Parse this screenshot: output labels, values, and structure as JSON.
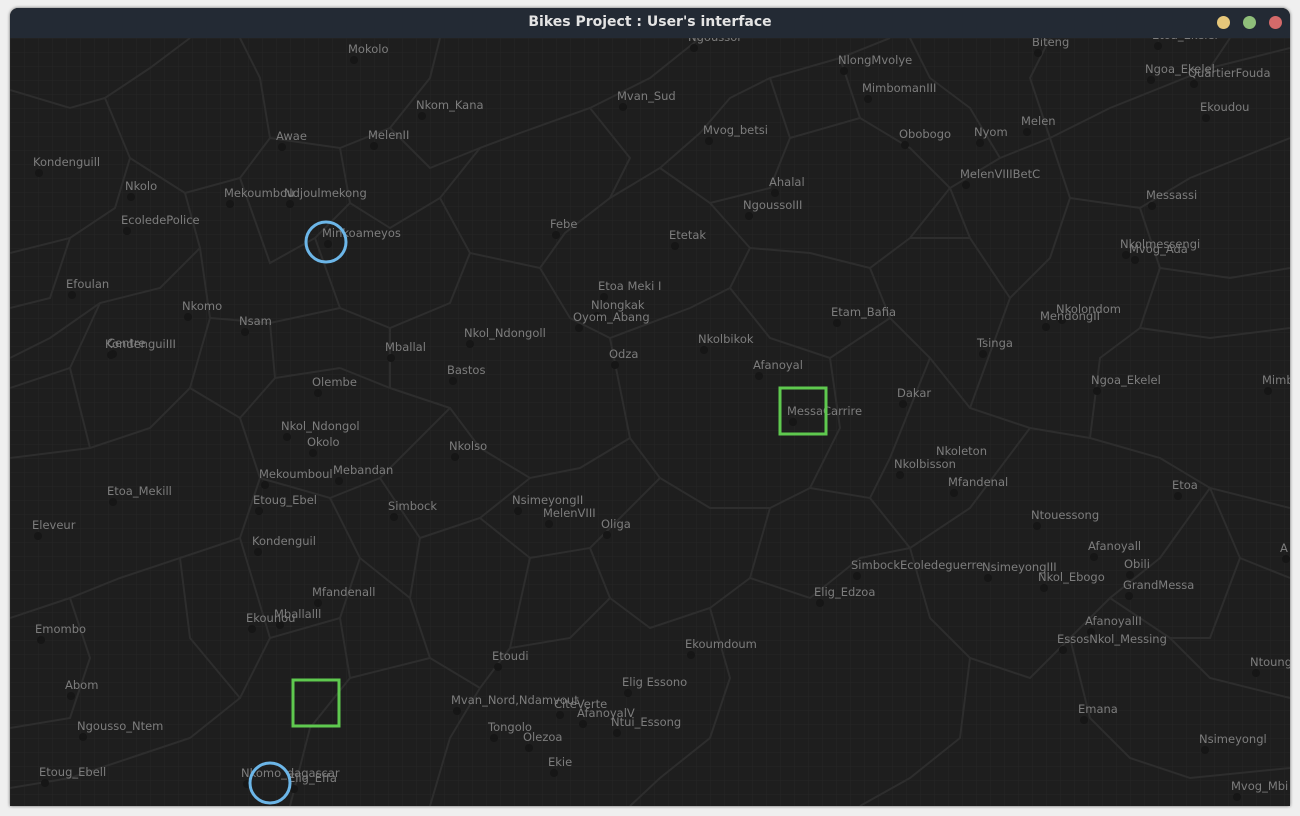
{
  "window": {
    "title": "Bikes Project : User's interface"
  },
  "colors": {
    "source_marker": "#6cb6e8",
    "target_marker": "#5fc94f",
    "station_label": "#7d7d7d",
    "background": "#1e1e1e",
    "grid": "#262626",
    "edge": "#2d2d2d"
  },
  "stations": [
    "Mokolo",
    "Ngoussol",
    "Biteng",
    "Etoa_Ekelel",
    "NlongMvolye",
    "Ngoa_Ekelel",
    "QuartierFouda",
    "MimbomanIII",
    "Mvan_Sud",
    "Nkom_Kana",
    "Ekoudou",
    "Awae",
    "MelenII",
    "Obobogo",
    "Nyom",
    "Melen",
    "Mvog_betsi",
    "Kondenguill",
    "Nkolo",
    "MelenVIIIBetC",
    "Ahalal",
    "Mekoumbou",
    "Ndjoulmekong",
    "Messassi",
    "NgoussoIII",
    "EcoledePolice",
    "Febe",
    "Minkoameyos",
    "Etetak",
    "Nkolmessengi",
    "Mvog_Ada",
    "Efoulan",
    "Etoa Meki I",
    "Nkomo",
    "Nlongkak",
    "Nkolondom",
    "Etam_Bafia",
    "MendongII",
    "Nsam",
    "Oyom_Abang",
    "Centre",
    "KondenguiIII",
    "Nkol_Ndongoll",
    "Nkolbikok",
    "Tsinga",
    "Mballal",
    "Odza",
    "Afanoyal",
    "Ngoa_Ekelel",
    "Bastos",
    "Mimb",
    "Olembe",
    "Dakar",
    "MessaCarrire",
    "Nkol_Ndongol",
    "Okolo",
    "Nkolso",
    "Nkoleton",
    "Nkolbisson",
    "Mebandan",
    "Mekoumboul",
    "Mfandenal",
    "Etoa",
    "Etoa_Mekill",
    "Etoug_Ebel",
    "NsimeyongII",
    "Simbock",
    "MelenVIII",
    "Ntouessong",
    "Oliga",
    "Eleveur",
    "Kondenguil",
    "Afanoyall",
    "A",
    "Obili",
    "SimbockEcoledeguerre",
    "NsimeyongIII",
    "Nkol_Ebogo",
    "GrandMessa",
    "Mfandenall",
    "Elig_Edzoa",
    "Ekounou",
    "Mballalll",
    "AfanoyalII",
    "Emombo",
    "Ekoumdoum",
    "EssosNkol_Messing",
    "Ntoung",
    "Etoudi",
    "Abom",
    "Elig Essono",
    "Mvan_Nord,Ndamvout",
    "CiteVerte",
    "AfanoyalV",
    "Emana",
    "Ntui_Essong",
    "Ngousso_Ntem",
    "Tongolo",
    "Olezoa",
    "Nsimeyongl",
    "Ekie",
    "Etoug_Ebell",
    "Nkomo_dagascar",
    "Elig_Effa",
    "Mvog_Mbi"
  ]
}
